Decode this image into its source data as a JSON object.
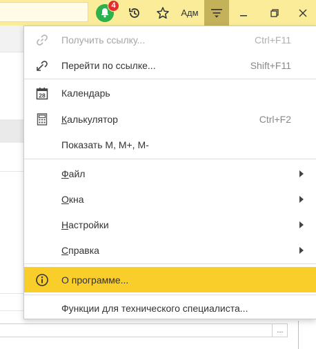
{
  "topbar": {
    "notification_count": "4",
    "user_label": "Адм",
    "accent_color": "#fbec9a",
    "bell_color": "#2bb24c",
    "badge_color": "#e52d2d",
    "icons": [
      "bell-icon",
      "history-icon",
      "star-icon",
      "main-menu-icon",
      "minimize-icon",
      "restore-icon",
      "close-icon"
    ]
  },
  "background": {
    "dots_button": "..."
  },
  "menu": {
    "items": [
      {
        "label": "Получить ссылку...",
        "shortcut": "Ctrl+F11",
        "icon": "link-icon",
        "disabled": true
      },
      {
        "label": "Перейти по ссылке...",
        "shortcut": "Shift+F11",
        "icon": "go-to-link-icon"
      },
      {
        "label": "Календарь",
        "icon": "calendar-icon",
        "calendar_day": "28"
      },
      {
        "label_first": "К",
        "label_rest": "алькулятор",
        "shortcut": "Ctrl+F2",
        "icon": "calculator-icon"
      },
      {
        "label": "Показать M, M+, M-"
      },
      {
        "label_first": "Ф",
        "label_rest": "айл",
        "submenu": true
      },
      {
        "label_first": "О",
        "label_rest": "кна",
        "submenu": true
      },
      {
        "label_first": "Н",
        "label_rest": "астройки",
        "submenu": true
      },
      {
        "label_first": "С",
        "label_rest": "правка",
        "submenu": true
      },
      {
        "label": "О программе...",
        "icon": "info-icon",
        "highlighted": true,
        "highlight_color": "#f9ce2b"
      },
      {
        "label": "Функции для технического специалиста..."
      }
    ]
  }
}
